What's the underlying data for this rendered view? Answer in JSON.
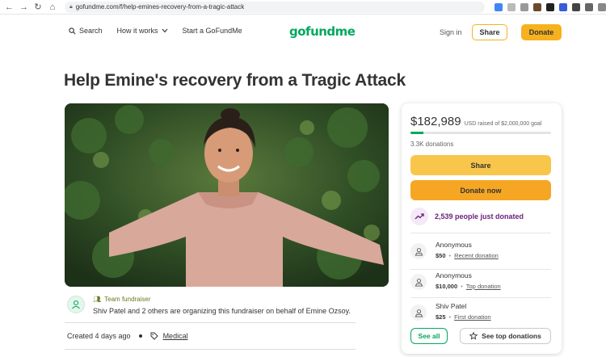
{
  "browser": {
    "url": "gofundme.com/f/help-emines-recovery-from-a-tragic-attack"
  },
  "header": {
    "search_label": "Search",
    "how_it_works_label": "How it works",
    "start_label": "Start a GoFundMe",
    "logo_text": "gofundme",
    "signin_label": "Sign in",
    "share_label": "Share",
    "donate_label": "Donate"
  },
  "campaign": {
    "title": "Help Emine's recovery from a Tragic Attack",
    "team_label": "Team fundraiser",
    "organizer_text": "Shiv Patel and 2 others are organizing this fundraiser on behalf of Emine Ozsoy.",
    "created": "Created 4 days ago",
    "category": "Medical"
  },
  "sidebar": {
    "raised_amount": "$182,989",
    "raised_goal_text": "USD raised of $2,000,000 goal",
    "progress_fraction": 0.0915,
    "donations_count": "3.3K donations",
    "share_label": "Share",
    "donate_label": "Donate now",
    "trending_text": "2,539 people just donated",
    "donors": [
      {
        "name": "Anonymous",
        "amount": "$50",
        "tag": "Recent donation"
      },
      {
        "name": "Anonymous",
        "amount": "$10,000",
        "tag": "Top donation"
      },
      {
        "name": "Shiv Patel",
        "amount": "$25",
        "tag": "First donation"
      }
    ],
    "see_all_label": "See all",
    "see_top_label": "See top donations"
  },
  "colors": {
    "brand_green": "#02a95c",
    "accent_yellow": "#f5b21e",
    "donate_orange": "#f5a623",
    "trend_purple": "#6a1f7a"
  }
}
